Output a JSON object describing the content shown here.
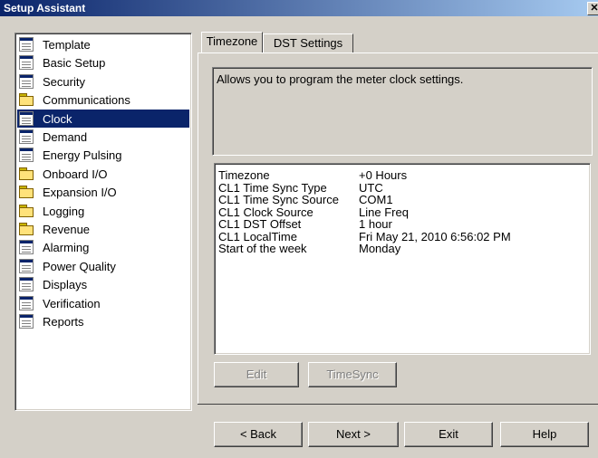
{
  "window": {
    "title": "Setup Assistant",
    "close_glyph": "✕"
  },
  "tree": {
    "items": [
      {
        "label": "Template",
        "icon": "document-icon",
        "selected": false
      },
      {
        "label": "Basic Setup",
        "icon": "document-icon",
        "selected": false
      },
      {
        "label": "Security",
        "icon": "document-icon",
        "selected": false
      },
      {
        "label": "Communications",
        "icon": "folder-icon",
        "selected": false
      },
      {
        "label": "Clock",
        "icon": "document-icon",
        "selected": true
      },
      {
        "label": "Demand",
        "icon": "document-icon",
        "selected": false
      },
      {
        "label": "Energy Pulsing",
        "icon": "document-icon",
        "selected": false
      },
      {
        "label": "Onboard I/O",
        "icon": "folder-icon",
        "selected": false
      },
      {
        "label": "Expansion I/O",
        "icon": "folder-icon",
        "selected": false
      },
      {
        "label": "Logging",
        "icon": "folder-icon",
        "selected": false
      },
      {
        "label": "Revenue",
        "icon": "folder-icon",
        "selected": false
      },
      {
        "label": "Alarming",
        "icon": "document-icon",
        "selected": false
      },
      {
        "label": "Power Quality",
        "icon": "document-icon",
        "selected": false
      },
      {
        "label": "Displays",
        "icon": "document-icon",
        "selected": false
      },
      {
        "label": "Verification",
        "icon": "document-icon",
        "selected": false
      },
      {
        "label": "Reports",
        "icon": "document-icon",
        "selected": false
      }
    ]
  },
  "tabs": [
    {
      "label": "Timezone",
      "active": true
    },
    {
      "label": "DST Settings",
      "active": false
    }
  ],
  "description": "Allows you to program the meter clock settings.",
  "properties": [
    {
      "name": "Timezone",
      "value": "+0 Hours"
    },
    {
      "name": "CL1 Time Sync Type",
      "value": "UTC"
    },
    {
      "name": "CL1 Time Sync Source",
      "value": "COM1"
    },
    {
      "name": "CL1 Clock Source",
      "value": "Line Freq"
    },
    {
      "name": "CL1 DST Offset",
      "value": "1 hour"
    },
    {
      "name": "CL1 LocalTime",
      "value": "Fri May 21, 2010 6:56:02 PM"
    },
    {
      "name": "Start of the week",
      "value": "Monday"
    }
  ],
  "panel_buttons": {
    "edit": "Edit",
    "timesync": "TimeSync"
  },
  "footer_buttons": {
    "back": "< Back",
    "next": "Next >",
    "exit": "Exit",
    "help": "Help"
  }
}
